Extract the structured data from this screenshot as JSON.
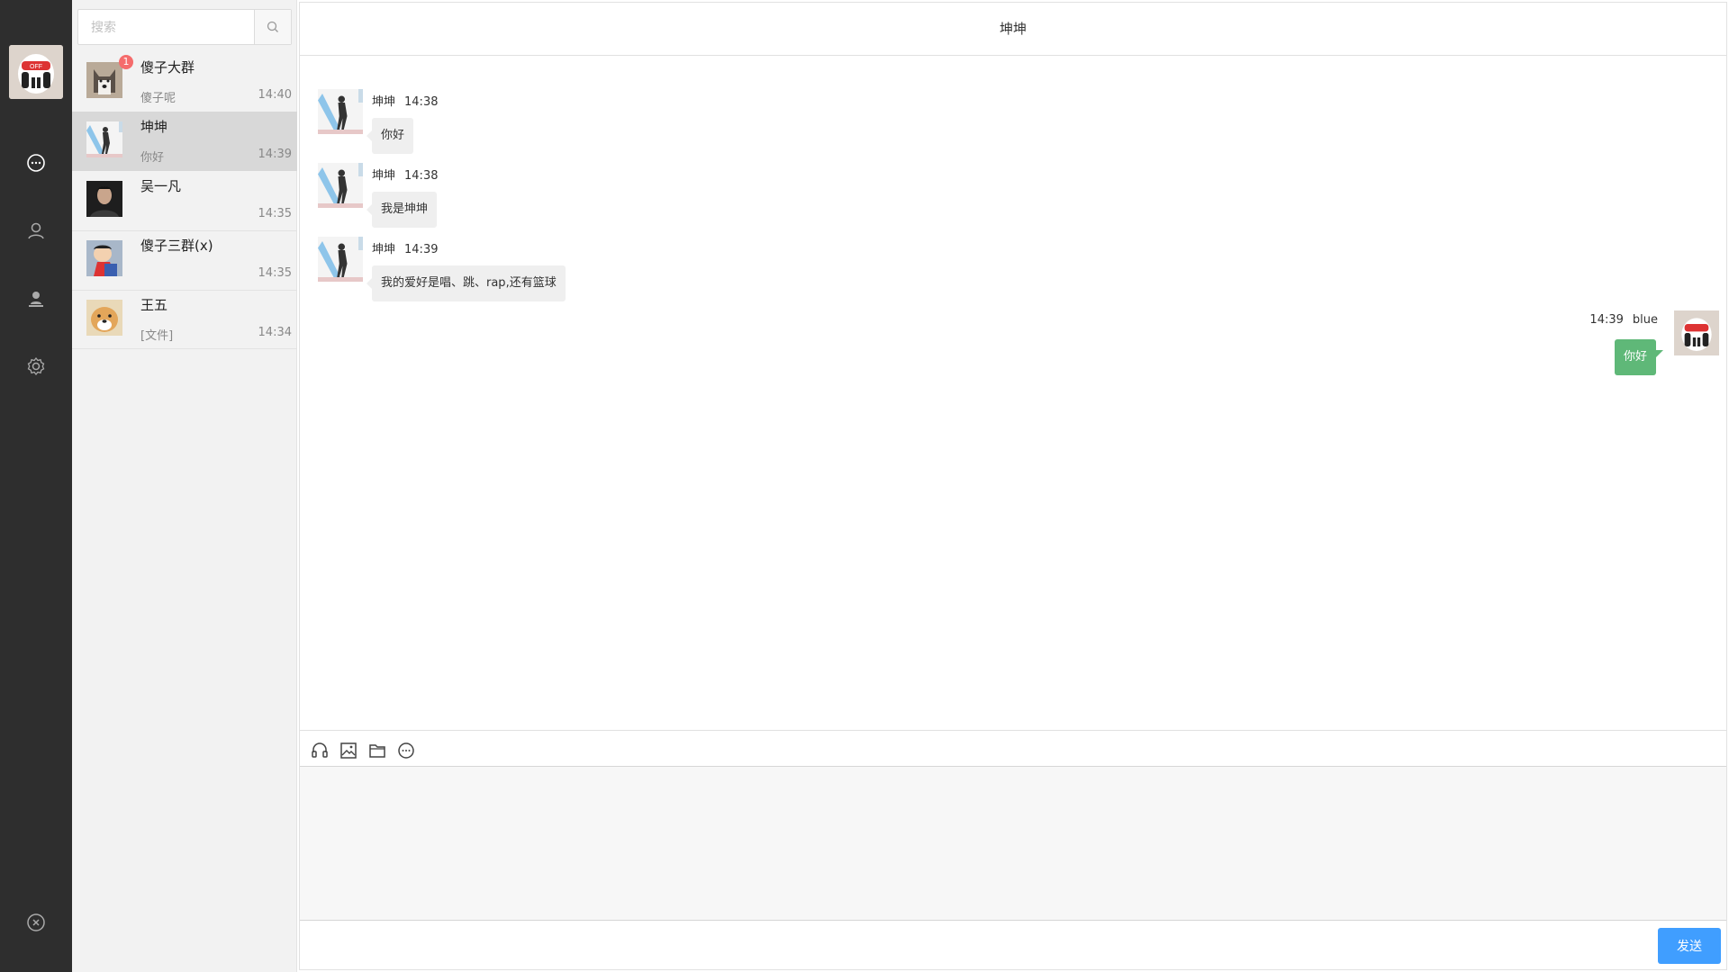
{
  "me": {
    "name": "blue",
    "avatar": "avatar-cartoon"
  },
  "nav": {
    "items": [
      {
        "icon": "chat-bubble-icon"
      },
      {
        "icon": "user-icon"
      },
      {
        "icon": "contacts-icon"
      },
      {
        "icon": "gear-icon"
      }
    ],
    "logout_icon": "close-circle-icon"
  },
  "search": {
    "placeholder": "搜索",
    "icon": "search-icon"
  },
  "conversations": [
    {
      "name": "傻子大群",
      "preview": "傻子呢",
      "time": "14:40",
      "badge": "1",
      "active": false,
      "avatar": "husky"
    },
    {
      "name": "坤坤",
      "preview": "你好",
      "time": "14:39",
      "active": true,
      "avatar": "dancer"
    },
    {
      "name": "吴一凡",
      "preview": "",
      "time": "14:35",
      "active": false,
      "avatar": "portrait"
    },
    {
      "name": "傻子三群(x)",
      "preview": "",
      "time": "14:35",
      "active": false,
      "avatar": "cartoon"
    },
    {
      "name": "王五",
      "preview": "[文件]",
      "time": "14:34",
      "active": false,
      "avatar": "shiba"
    }
  ],
  "chat": {
    "title": "坤坤",
    "messages": [
      {
        "sender": "坤坤",
        "time": "14:38",
        "text": "你好",
        "direction": "in"
      },
      {
        "sender": "坤坤",
        "time": "14:38",
        "text": "我是坤坤",
        "direction": "in"
      },
      {
        "sender": "坤坤",
        "time": "14:39",
        "text": "我的爱好是唱、跳、rap,还有篮球",
        "direction": "in"
      },
      {
        "sender": "blue",
        "time": "14:39",
        "text": "你好",
        "direction": "out"
      }
    ],
    "toolbar": [
      "headset-icon",
      "image-icon",
      "folder-icon",
      "emoji-chat-icon"
    ],
    "send_label": "发送"
  },
  "colors": {
    "rail": "#2e2e2e",
    "send_button": "#409eff",
    "out_bubble": "#5fb878",
    "badge": "#f56c6c"
  }
}
